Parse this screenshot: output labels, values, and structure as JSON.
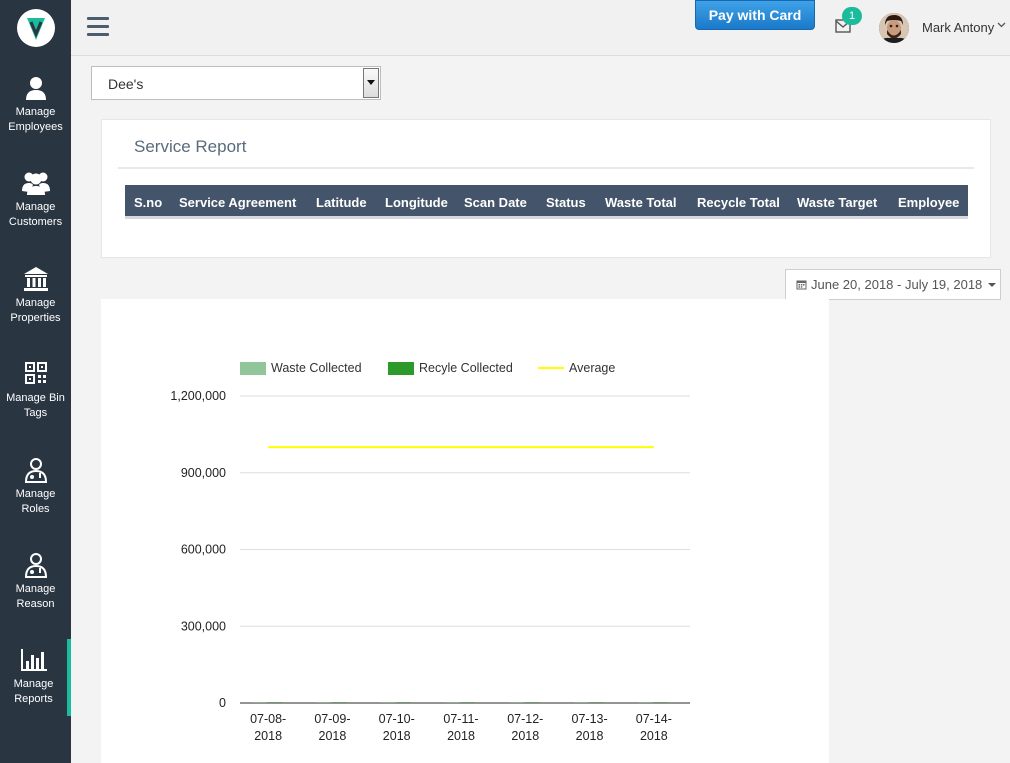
{
  "sidebar": {
    "items": [
      {
        "label_line1": "Manage",
        "label_line2": "Employees",
        "icon": "user-icon"
      },
      {
        "label_line1": "Manage",
        "label_line2": "Customers",
        "icon": "users-icon"
      },
      {
        "label_line1": "Manage",
        "label_line2": "Properties",
        "icon": "bank-icon"
      },
      {
        "label_line1": "Manage Bin",
        "label_line2": "Tags",
        "icon": "qrcode-icon"
      },
      {
        "label_line1": "Manage",
        "label_line2": "Roles",
        "icon": "user-md-icon"
      },
      {
        "label_line1": "Manage",
        "label_line2": "Reason",
        "icon": "user-md-icon"
      },
      {
        "label_line1": "Manage",
        "label_line2": "Reports",
        "icon": "bar-chart-icon"
      }
    ],
    "active_index": 6,
    "accent_color": "#1abc9c"
  },
  "header": {
    "pay_button": "Pay with Card",
    "notification_count": "1",
    "user_name": "Mark Antony"
  },
  "filter": {
    "property_select": "Dee's"
  },
  "service_report": {
    "title": "Service Report",
    "columns": [
      "S.no",
      "Service Agreement",
      "Latitude",
      "Longitude",
      "Scan Date",
      "Status",
      "Waste Total",
      "Recycle Total",
      "Waste Target",
      "Employee"
    ]
  },
  "date_range": {
    "label": "June 20, 2018 - July 19, 2018"
  },
  "chart_data": {
    "type": "bar",
    "categories": [
      "07-08-2018",
      "07-09-2018",
      "07-10-2018",
      "07-11-2018",
      "07-12-2018",
      "07-13-2018",
      "07-14-2018"
    ],
    "category_lines": [
      [
        "07-08-",
        "2018"
      ],
      [
        "07-09-",
        "2018"
      ],
      [
        "07-10-",
        "2018"
      ],
      [
        "07-11-",
        "2018"
      ],
      [
        "07-12-",
        "2018"
      ],
      [
        "07-13-",
        "2018"
      ],
      [
        "07-14-",
        "2018"
      ]
    ],
    "series": [
      {
        "name": "Waste Collected",
        "type": "bar",
        "color": "#93c59b",
        "values": [
          0,
          0,
          0,
          0,
          0,
          0,
          0
        ]
      },
      {
        "name": "Recyle Collected",
        "type": "bar",
        "color": "#2b9a2b",
        "values": [
          0,
          0,
          0,
          0,
          0,
          0,
          0
        ]
      },
      {
        "name": "Average",
        "type": "line",
        "color": "#ffff00",
        "values": [
          1000000,
          1000000,
          1000000,
          1000000,
          1000000,
          1000000,
          1000000
        ]
      }
    ],
    "ylim": [
      0,
      1200000
    ],
    "yticks": [
      0,
      300000,
      600000,
      900000,
      1200000
    ],
    "ytick_labels": [
      "0",
      "300,000",
      "600,000",
      "900,000",
      "1,200,000"
    ],
    "grid": true,
    "legend_position": "top"
  }
}
